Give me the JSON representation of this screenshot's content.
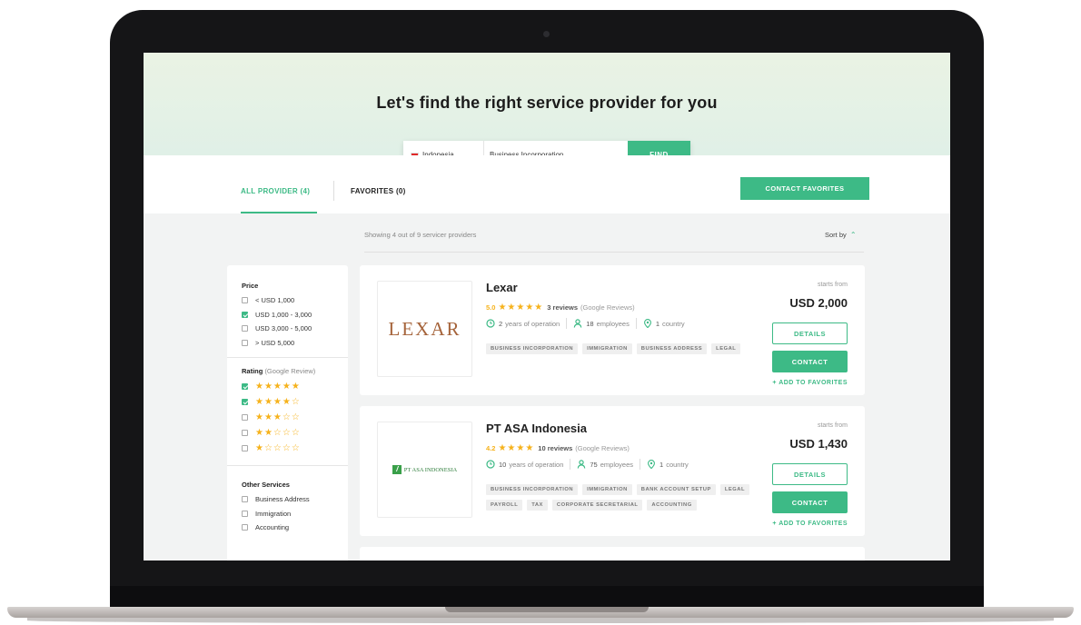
{
  "hero": {
    "title": "Let's find the right service provider for you"
  },
  "search": {
    "country": "Indonesia",
    "service": "Business Incorporation",
    "find_label": "FIND"
  },
  "tabs": {
    "all_label": "ALL PROVIDER (4)",
    "favorites_label": "FAVORITES (0)",
    "contact_favorites_label": "CONTACT FAVORITES"
  },
  "results": {
    "showing_text": "Showing 4 out of 9 servicer providers",
    "sort_label": "Sort by"
  },
  "filters": {
    "price": {
      "title": "Price",
      "options": [
        {
          "label": "< USD 1,000",
          "checked": false
        },
        {
          "label": "USD 1,000 - 3,000",
          "checked": true
        },
        {
          "label": "USD 3,000 - 5,000",
          "checked": false
        },
        {
          "label": "> USD 5,000",
          "checked": false
        }
      ]
    },
    "rating": {
      "title": "Rating",
      "subtitle": "(Google Review)",
      "options": [
        {
          "stars": "★★★★★",
          "rating": 5,
          "checked": true
        },
        {
          "stars": "★★★★☆",
          "rating": 4,
          "checked": true
        },
        {
          "stars": "★★★☆☆",
          "rating": 3,
          "checked": false
        },
        {
          "stars": "★★☆☆☆",
          "rating": 2,
          "checked": false
        },
        {
          "stars": "★☆☆☆☆",
          "rating": 1,
          "checked": false
        }
      ]
    },
    "other_services": {
      "title": "Other Services",
      "options": [
        {
          "label": "Business Address",
          "checked": false
        },
        {
          "label": "Immigration",
          "checked": false
        },
        {
          "label": "Accounting",
          "checked": false
        }
      ]
    }
  },
  "providers": [
    {
      "name": "Lexar",
      "logo_text": "LEXAR",
      "score": "5.0",
      "stars": "★★★★★",
      "reviews": "3 reviews",
      "review_source": "(Google Reviews)",
      "years_value": "2",
      "years_text": "years of operation",
      "employees_value": "18",
      "employees_text": "employees",
      "countries_value": "1",
      "countries_text": "country",
      "tags": [
        "BUSINESS INCORPORATION",
        "IMMIGRATION",
        "BUSINESS ADDRESS",
        "LEGAL"
      ],
      "starts_from": "starts from",
      "price": "USD 2,000",
      "details_label": "DETAILS",
      "contact_label": "CONTACT",
      "add_favorites_label": "+ ADD TO FAVORITES"
    },
    {
      "name": "PT ASA Indonesia",
      "logo_text": "PT ASA INDONESIA",
      "score": "4.2",
      "stars": "★★★★",
      "reviews": "10 reviews",
      "review_source": "(Google Reviews)",
      "years_value": "10",
      "years_text": "years of operation",
      "employees_value": "75",
      "employees_text": "employees",
      "countries_value": "1",
      "countries_text": "country",
      "tags": [
        "BUSINESS INCORPORATION",
        "IMMIGRATION",
        "BANK ACCOUNT SETUP",
        "LEGAL",
        "PAYROLL",
        "TAX",
        "CORPORATE SECRETARIAL",
        "ACCOUNTING"
      ],
      "starts_from": "starts from",
      "price": "USD 1,430",
      "details_label": "DETAILS",
      "contact_label": "CONTACT",
      "add_favorites_label": "+ ADD TO FAVORITES"
    }
  ],
  "colors": {
    "accent": "#3dba86",
    "star": "#f6b21b",
    "lexar_brand": "#a5633a",
    "asa_brand": "#2e7d3b"
  },
  "icons": {
    "clock": "clock-icon",
    "person": "person-icon",
    "location": "location-pin-icon",
    "sort": "chevron-up-icon"
  }
}
